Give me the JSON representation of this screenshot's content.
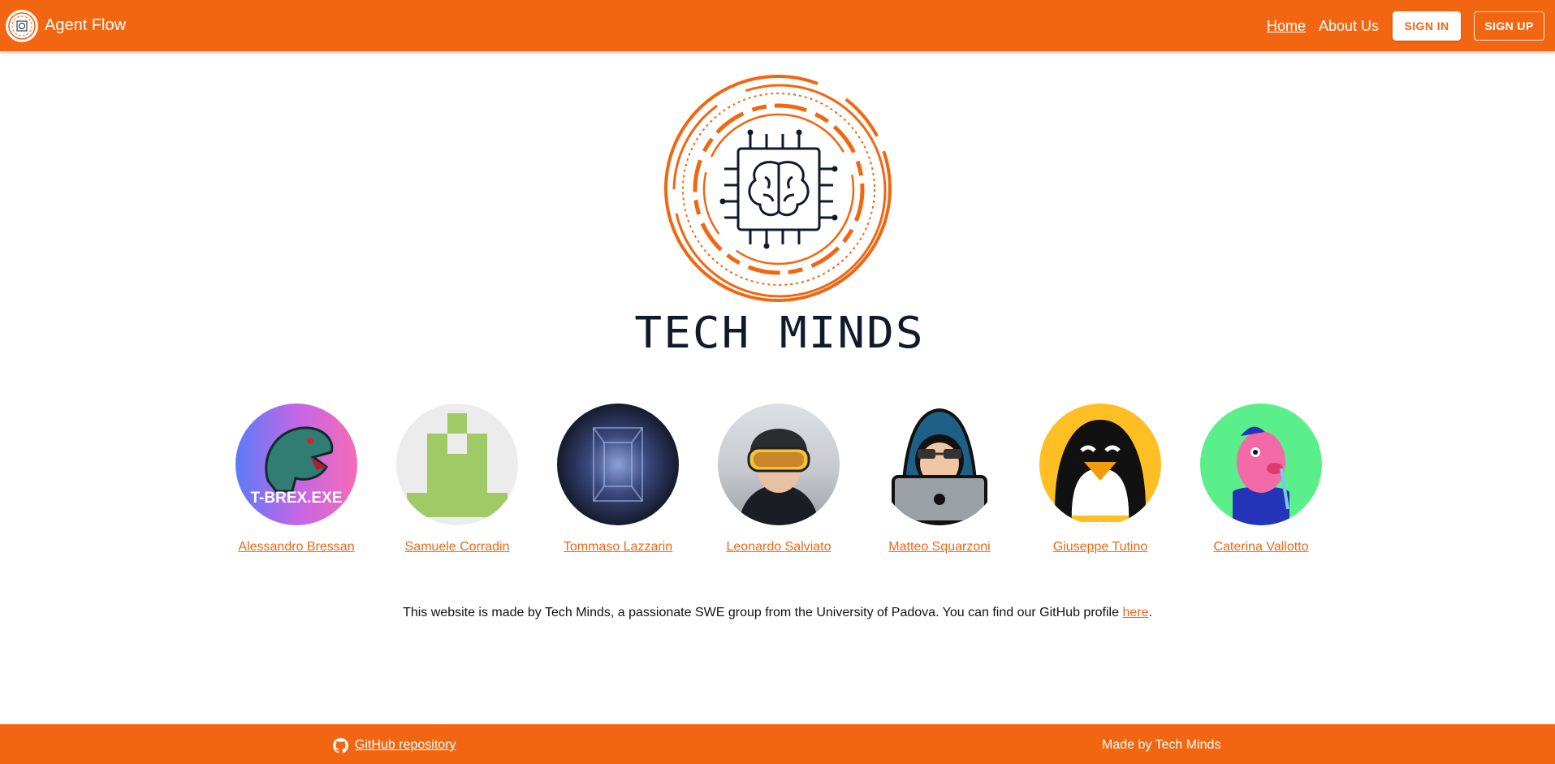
{
  "header": {
    "app_name": "Agent Flow",
    "nav": {
      "home": "Home",
      "about": "About Us"
    },
    "sign_in": "SIGN IN",
    "sign_up": "SIGN UP"
  },
  "hero": {
    "title": "TECH MINDS"
  },
  "team": {
    "members": [
      {
        "name": "Alessandro Bressan",
        "avatar_text": "T-BREX.EXE"
      },
      {
        "name": "Samuele Corradin"
      },
      {
        "name": "Tommaso Lazzarin"
      },
      {
        "name": "Leonardo Salviato"
      },
      {
        "name": "Matteo Squarzoni"
      },
      {
        "name": "Giuseppe Tutino"
      },
      {
        "name": "Caterina Vallotto"
      }
    ]
  },
  "about": {
    "text": "This website is made by Tech Minds, a passionate SWE group from the University of Padova. You can find our GitHub profile ",
    "link": "here",
    "suffix": "."
  },
  "footer": {
    "github_link": "GitHub repository",
    "made_by": "Made by Tech Minds"
  },
  "colors": {
    "accent": "#f26611",
    "navy": "#0f1b2d"
  },
  "icons": [
    "brain-chip-icon",
    "github-icon"
  ]
}
